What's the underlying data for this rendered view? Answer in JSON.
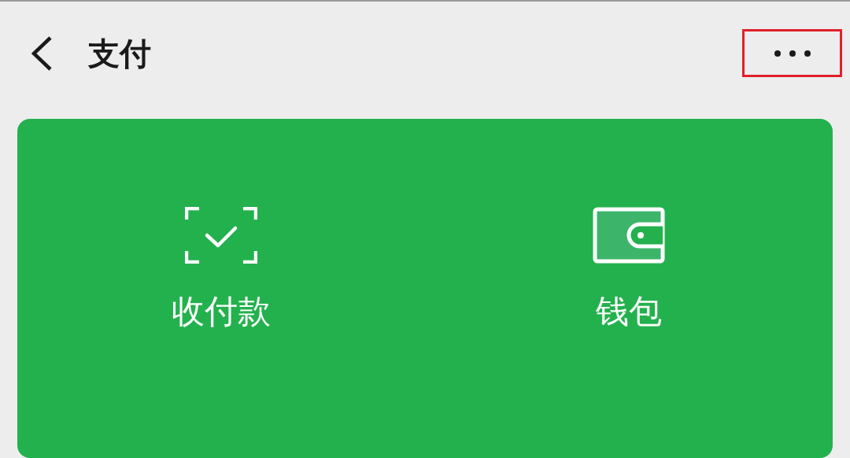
{
  "header": {
    "title": "支付",
    "more_highlighted": true
  },
  "card": {
    "items": [
      {
        "kind": "scan",
        "label": "收付款"
      },
      {
        "kind": "wallet",
        "label": "钱包"
      }
    ]
  }
}
